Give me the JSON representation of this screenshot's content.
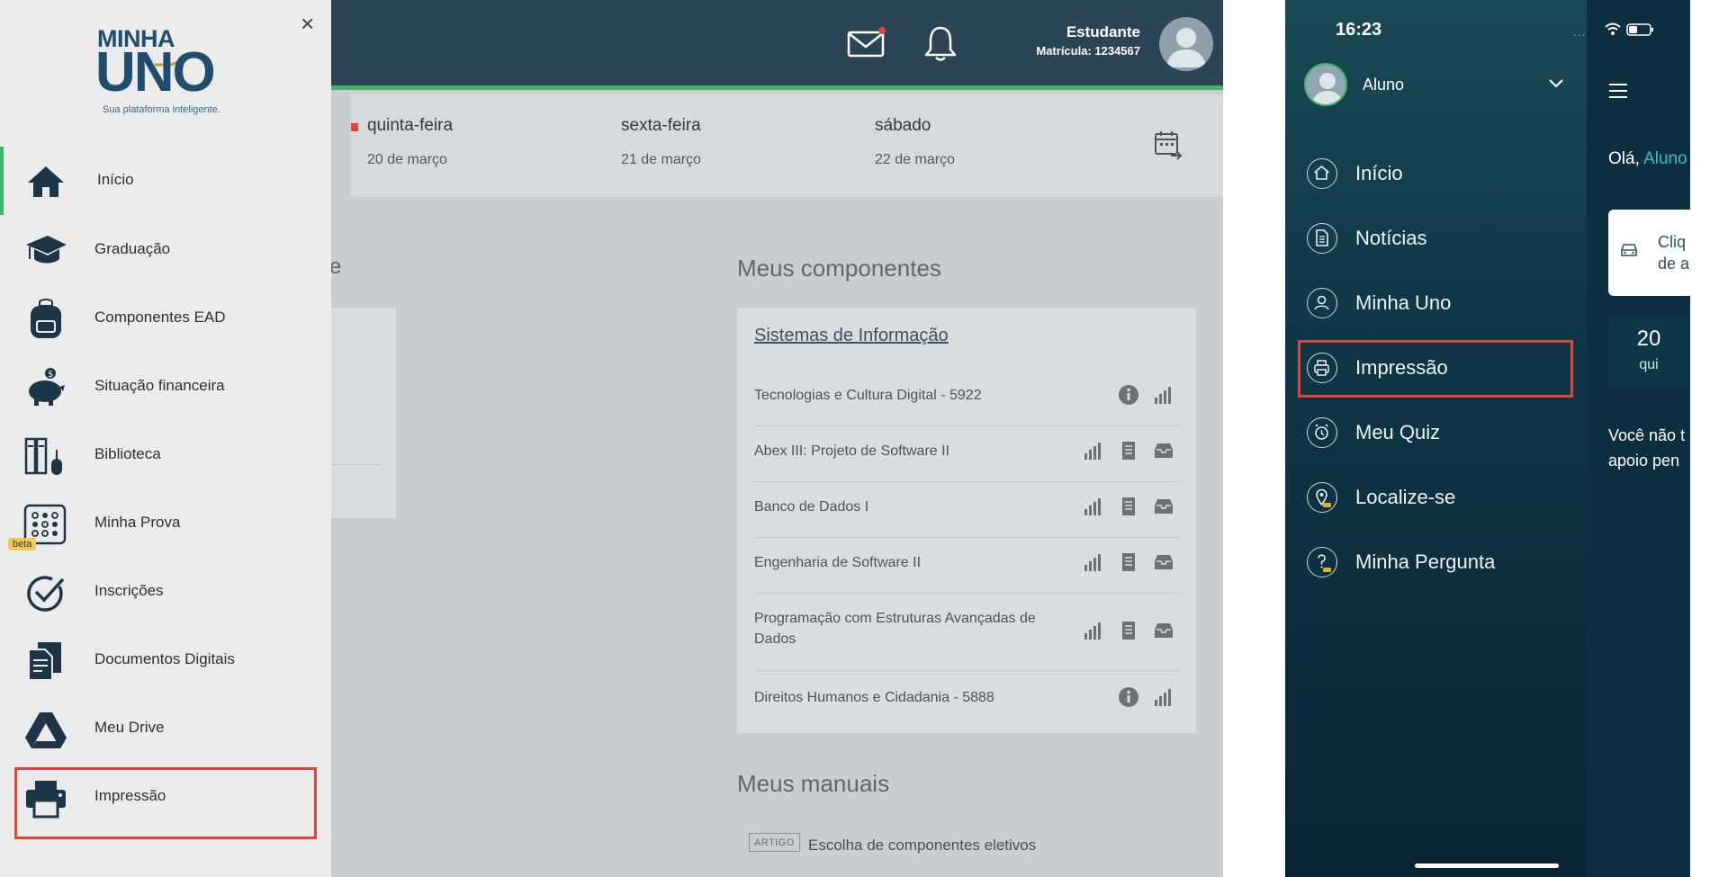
{
  "desktop": {
    "header": {
      "user_name": "Estudante",
      "user_registration": "Matrícula: 1234567"
    },
    "week": [
      {
        "name": "quinta-feira",
        "date": "20 de março"
      },
      {
        "name": "sexta-feira",
        "date": "21 de março"
      },
      {
        "name": "sábado",
        "date": "22 de março"
      }
    ],
    "faded_label": "e",
    "components": {
      "title": "Meus componentes",
      "course": "Sistemas de Informação",
      "items": [
        {
          "name": "Tecnologias e Cultura Digital - 5922",
          "icons": [
            "info-icon",
            "stats-icon"
          ]
        },
        {
          "name": "Abex III: Projeto de Software II",
          "icons": [
            "stats-icon",
            "notes-icon",
            "inbox-icon"
          ]
        },
        {
          "name": "Banco de Dados I",
          "icons": [
            "stats-icon",
            "notes-icon",
            "inbox-icon"
          ]
        },
        {
          "name": "Engenharia de Software II",
          "icons": [
            "stats-icon",
            "notes-icon",
            "inbox-icon"
          ]
        },
        {
          "name": "Programação com Estruturas Avançadas de Dados",
          "icons": [
            "stats-icon",
            "notes-icon",
            "inbox-icon"
          ]
        },
        {
          "name": "Direitos Humanos e Cidadania - 5888",
          "icons": [
            "info-icon",
            "stats-icon"
          ]
        }
      ]
    },
    "manuals": {
      "title": "Meus manuais",
      "badge": "ARTIGO",
      "link": "Escolha de componentes eletivos"
    },
    "sidebar": {
      "close": "×",
      "logo_top": "MINHA",
      "logo_main": "UNO",
      "logo_tagline": "Sua plataforma inteligente.",
      "beta": "beta",
      "items": [
        {
          "label": "Início",
          "icon": "home-icon"
        },
        {
          "label": "Graduação",
          "icon": "graduation-cap-icon"
        },
        {
          "label": "Componentes EAD",
          "icon": "backpack-icon"
        },
        {
          "label": "Situação financeira",
          "icon": "piggy-bank-icon"
        },
        {
          "label": "Biblioteca",
          "icon": "library-icon"
        },
        {
          "label": "Minha Prova",
          "icon": "exam-grid-icon"
        },
        {
          "label": "Inscrições",
          "icon": "check-circle-icon"
        },
        {
          "label": "Documentos Digitais",
          "icon": "documents-icon"
        },
        {
          "label": "Meu Drive",
          "icon": "drive-icon"
        },
        {
          "label": "Impressão",
          "icon": "printer-icon"
        }
      ]
    }
  },
  "phone": {
    "status_time": "16:23",
    "status_dots": "....",
    "user": "Aluno",
    "menu": [
      {
        "label": "Início",
        "icon": "home-icon"
      },
      {
        "label": "Notícias",
        "icon": "news-icon"
      },
      {
        "label": "Minha Uno",
        "icon": "profile-icon"
      },
      {
        "label": "Impressão",
        "icon": "printer-icon"
      },
      {
        "label": "Meu Quiz",
        "icon": "alarm-icon"
      },
      {
        "label": "Localize-se",
        "icon": "location-icon"
      },
      {
        "label": "Minha Pergunta",
        "icon": "question-icon"
      }
    ],
    "main": {
      "greeting": "Olá, ",
      "greeting_name": "Aluno",
      "card_text": "Cliq\nde a",
      "date_day": "20",
      "date_weekday": "qui",
      "info_text": "Você não t\napoio pen"
    }
  },
  "colors": {
    "accent_green": "#3fb46a",
    "highlight_red": "#e0443a",
    "header_navy": "#2c4556",
    "brand_blue": "#1e4d6e"
  }
}
